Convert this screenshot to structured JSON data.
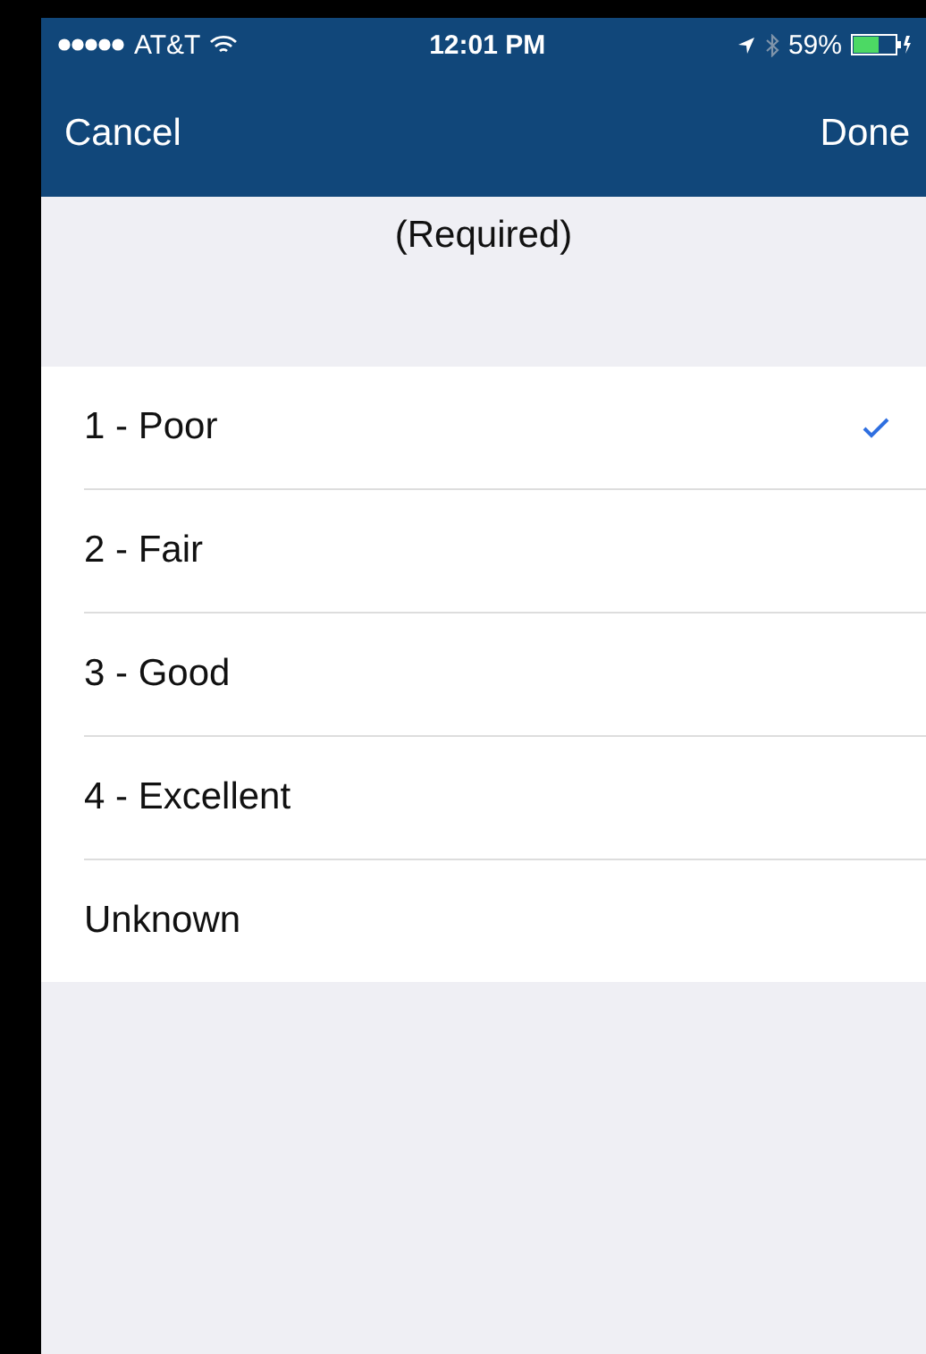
{
  "status_bar": {
    "carrier": "AT&T",
    "time": "12:01 PM",
    "battery_percent": "59%"
  },
  "nav_bar": {
    "left_button": "Cancel",
    "right_button": "Done"
  },
  "section_header": "(Required)",
  "options": [
    {
      "label": "1 - Poor",
      "selected": true
    },
    {
      "label": "2 - Fair",
      "selected": false
    },
    {
      "label": "3 - Good",
      "selected": false
    },
    {
      "label": "4 - Excellent",
      "selected": false
    },
    {
      "label": "Unknown",
      "selected": false
    }
  ]
}
